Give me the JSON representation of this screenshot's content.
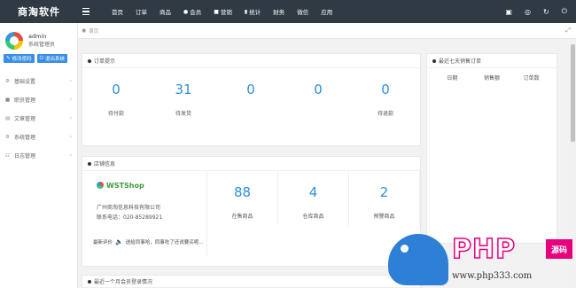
{
  "app": {
    "brand": "商淘软件"
  },
  "topnav": {
    "items": [
      {
        "label": "首页",
        "icon": ""
      },
      {
        "label": "订单",
        "icon": ""
      },
      {
        "label": "商品",
        "icon": ""
      },
      {
        "label": "会员",
        "icon": "user-icon"
      },
      {
        "label": "营销",
        "icon": "cart-icon"
      },
      {
        "label": "统计",
        "icon": "bar-chart-icon"
      },
      {
        "label": "财务",
        "icon": ""
      },
      {
        "label": "微信",
        "icon": ""
      },
      {
        "label": "应用",
        "icon": ""
      }
    ],
    "right_icons": [
      "monitor-icon",
      "eye-icon",
      "refresh-icon",
      "power-icon"
    ]
  },
  "sidebar": {
    "user": {
      "name": "admin",
      "role": "系统管理员"
    },
    "buttons": {
      "change_password": "修改密码",
      "logout": "退出系统"
    },
    "items": [
      {
        "label": "基础设置",
        "icon": "gear-icon"
      },
      {
        "label": "职员管理",
        "icon": "users-icon"
      },
      {
        "label": "文章管理",
        "icon": "book-icon"
      },
      {
        "label": "系统管理",
        "icon": "gear-icon"
      },
      {
        "label": "日志管理",
        "icon": "log-icon"
      }
    ]
  },
  "breadcrumb": {
    "home": "首页"
  },
  "orders_panel": {
    "title": "订单提示",
    "stats": [
      {
        "value": "0",
        "label": "待付款"
      },
      {
        "value": "31",
        "label": "待发货"
      },
      {
        "value": "0",
        "label": ""
      },
      {
        "value": "0",
        "label": ""
      },
      {
        "value": "0",
        "label": "待退款"
      }
    ]
  },
  "store_panel": {
    "title": "店铺信息",
    "logo_text": "WSTShop",
    "company": "广州商淘信息科技有限公司",
    "phone": "联系电话：020-85289921",
    "stats": [
      {
        "value": "88",
        "label": "在售商品"
      },
      {
        "value": "4",
        "label": "仓库商品"
      },
      {
        "value": "2",
        "label": "预警商品"
      }
    ],
    "review_label": "最新评价",
    "review_text": "送给同事哈，同事吃了还说要买呢..."
  },
  "sales_panel": {
    "title": "最近七天销售订单",
    "columns": [
      "日期",
      "销售额",
      "订单数"
    ]
  },
  "login_panel": {
    "title": "最近一个月会员登录情况"
  },
  "watermark": {
    "php": "PHP",
    "yuanma": "源码",
    "site": "www.php333.com"
  }
}
